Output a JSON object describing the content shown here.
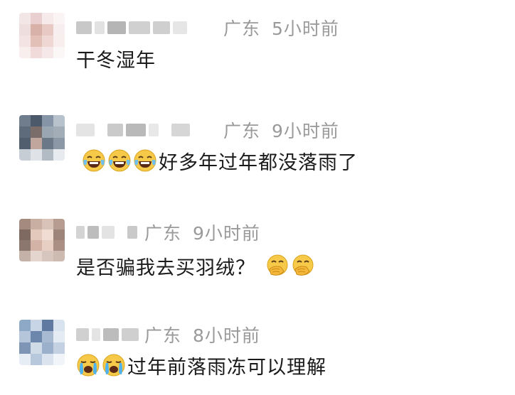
{
  "comments": [
    {
      "location": "广东",
      "time": "5小时前",
      "text": "干冬湿年",
      "emojis": []
    },
    {
      "location": "广东",
      "time": "9小时前",
      "text": "好多年过年都没落雨了",
      "emojis": [
        "tears-of-joy-emoji",
        "tears-of-joy-emoji",
        "tears-of-joy-emoji"
      ]
    },
    {
      "location": "广东",
      "time": "9小时前",
      "text": "是否骗我去买羽绒？",
      "emojis_after": [
        "hand-over-mouth-emoji",
        "hand-over-mouth-emoji"
      ]
    },
    {
      "location": "广东",
      "time": "8小时前",
      "text": "过年前落雨冻可以理解",
      "emojis": [
        "loudly-crying-emoji",
        "loudly-crying-emoji"
      ]
    }
  ],
  "colors": {
    "meta": "#9a9a9a",
    "text": "#1a1a1a"
  }
}
